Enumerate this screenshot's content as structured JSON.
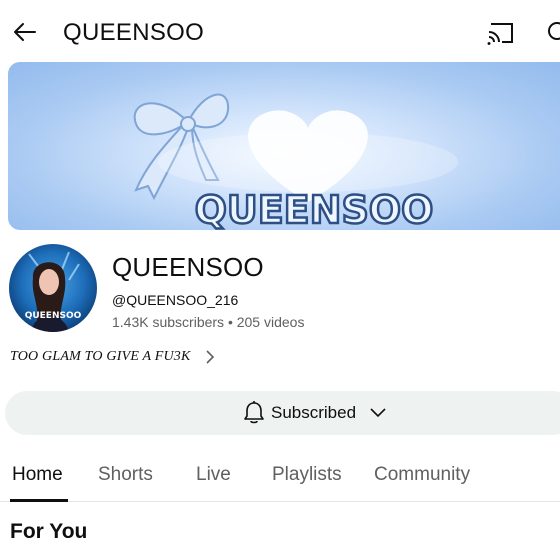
{
  "appbar": {
    "title": "QUEENSOO"
  },
  "banner": {
    "text": "QUEENSOO"
  },
  "channel": {
    "name": "QUEENSOO",
    "handle": "@QUEENSOO_216",
    "stats": "1.43K subscribers • 205 videos",
    "description": "TOO GLAM TO GIVE A FU3K",
    "avatar_label": "QUEENSOO"
  },
  "subscribe": {
    "label": "Subscribed"
  },
  "tabs": [
    {
      "label": "Home",
      "active": true
    },
    {
      "label": "Shorts",
      "active": false
    },
    {
      "label": "Live",
      "active": false
    },
    {
      "label": "Playlists",
      "active": false
    },
    {
      "label": "Community",
      "active": false
    }
  ],
  "section": {
    "title": "For You"
  },
  "icons": {
    "back": "arrow-left-icon",
    "cast": "cast-icon",
    "search": "search-icon",
    "bell": "bell-icon",
    "caret": "chevron-down-icon",
    "desc_chevron": "chevron-right-icon"
  },
  "colors": {
    "banner_blue": "#a8c9f2",
    "text_stroke": "#2d4f86",
    "subscribe_bg": "#eef2f1",
    "secondary_text": "#606060"
  }
}
